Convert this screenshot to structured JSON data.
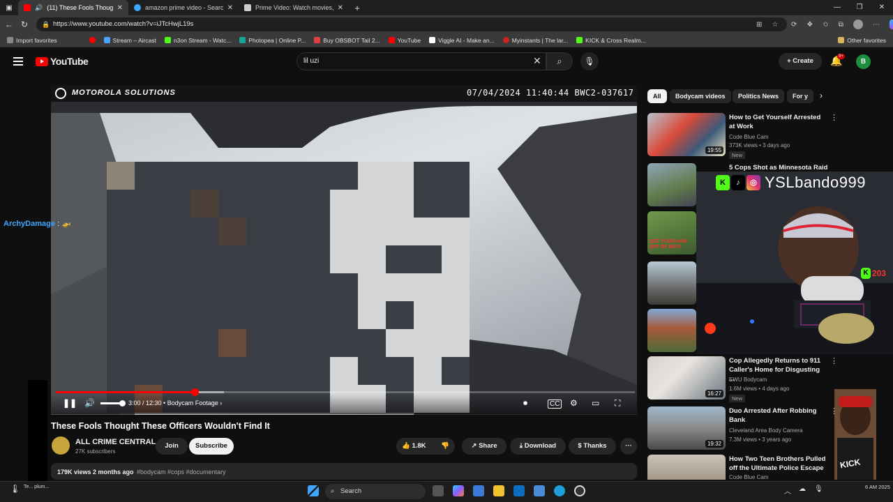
{
  "browser": {
    "tabs": [
      {
        "title": "(11) These Fools Thought Th",
        "active": true,
        "color": "#ff0000"
      },
      {
        "title": "amazon prime video - Search",
        "active": false,
        "color": "#3ea6ff"
      },
      {
        "title": "Prime Video: Watch movies, TV sh",
        "active": false,
        "color": "#cccccc"
      }
    ],
    "new_tab": "+",
    "url": "https://www.youtube.com/watch?v=iJTcHwjL19s",
    "bookmarks": [
      {
        "label": "Import favorites",
        "color": "#888888"
      },
      {
        "label": "",
        "color": "#ff0000"
      },
      {
        "label": "Stream – Aircast",
        "color": "#4aa3ff"
      },
      {
        "label": "n3on Stream - Watc...",
        "color": "#53fc18"
      },
      {
        "label": "Photopea | Online P...",
        "color": "#18a497"
      },
      {
        "label": "Buy OBSBOT Tail 2...",
        "color": "#e04040"
      },
      {
        "label": "YouTube",
        "color": "#ff0000"
      },
      {
        "label": "Viggle AI - Make an...",
        "color": "#ffffff"
      },
      {
        "label": "Myinstants | The lar...",
        "color": "#cc2222"
      },
      {
        "label": "KICK & Cross Realm...",
        "color": "#53fc18"
      }
    ],
    "other_favorites": "Other favorites"
  },
  "youtube": {
    "logo_text": "YouTube",
    "search_value": "lil uzi",
    "create_label": "Create",
    "notif_count": "9+",
    "avatar_letter": "B"
  },
  "video": {
    "brand": "MOTOROLA SOLUTIONS",
    "timestamp": "07/04/2024 11:40:44   BWC2-037617",
    "chat_user": "ArchyDamage",
    "chat_message": " : 🚁",
    "time_display": "3:00 / 12:30",
    "chapter": "Bodycam Footage",
    "progress_fraction": 0.24,
    "buffer_fraction": 0.29,
    "volume_fraction": 0.8
  },
  "details": {
    "title": "These Fools Thought These Officers Wouldn't Find It",
    "channel": "ALL CRIME CENTRAL",
    "subscribers": "27K subscribers",
    "join": "Join",
    "subscribe": "Subscribe",
    "likes": "1.8K",
    "share": "Share",
    "download": "Download",
    "thanks": "Thanks",
    "more": "···",
    "views": "179K views  2 months ago",
    "tags": "#bodycam #cops #documentary"
  },
  "sidebar": {
    "chips": [
      "All",
      "Bodycam videos",
      "Politics News",
      "For y"
    ],
    "recs": [
      {
        "title": "How to Get Yourself Arrested at Work",
        "channel": "Code Blue Cam",
        "meta": "373K views • 3 days ago",
        "duration": "19:55",
        "new": "New"
      },
      {
        "title": "5 Cops Shot as Minnesota Raid",
        "channel": "",
        "meta": "",
        "duration": "",
        "new": ""
      },
      {
        "title": "Cop Allegedly Returns to 911 Caller's Home for Disgusting ...",
        "channel": "EWU Bodycam",
        "meta": "1.6M views • 4 days ago",
        "duration": "16:27",
        "new": "New"
      },
      {
        "title": "Duo Arrested After Robbing Bank",
        "channel": "Cleveland Area Body Camera",
        "meta": "7.3M views • 3 years ago",
        "duration": "19:32",
        "new": ""
      },
      {
        "title": "How Two Teen Brothers Pulled off the Ultimate Police Escape",
        "channel": "Code Blue Cam",
        "meta": "",
        "duration": "",
        "new": ""
      }
    ],
    "thumb_caption": "GET YOUR HAN OFF OF ME!!!"
  },
  "stream_overlay": {
    "handle": "YSLbando999",
    "kick_count": "203",
    "cap_text": "KICK"
  },
  "taskbar": {
    "search": "Search",
    "weather": "Te... plum...",
    "clock": "6 AM 2025"
  }
}
